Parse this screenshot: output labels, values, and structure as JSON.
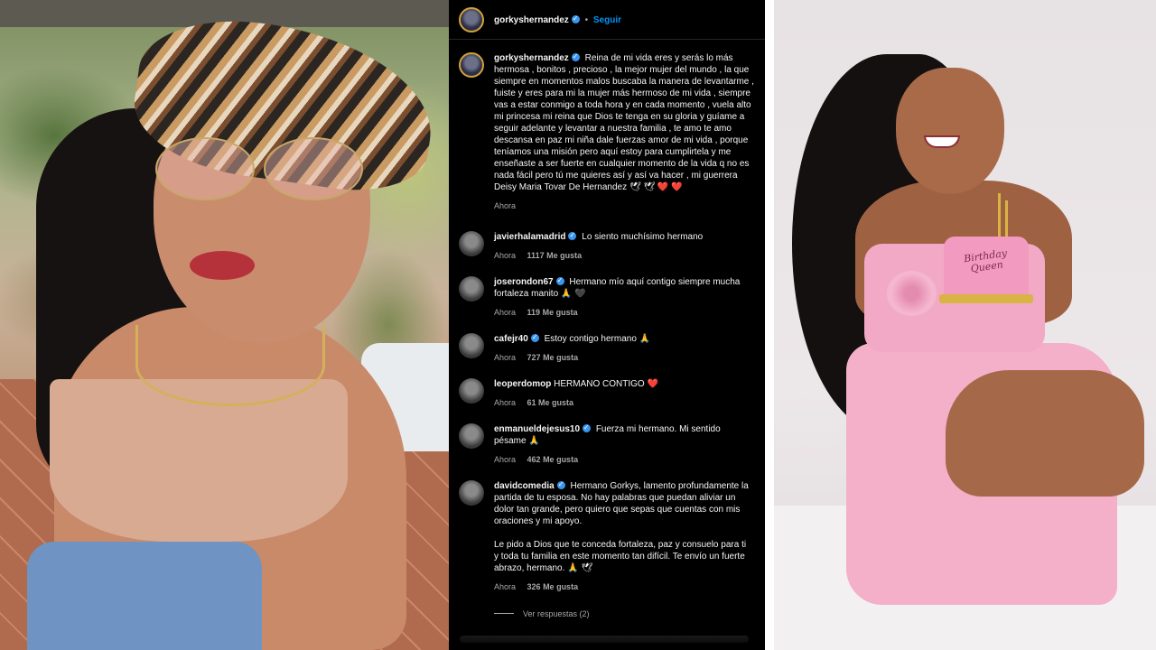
{
  "post": {
    "author": "gorkyshernandez",
    "follow_label": "Seguir",
    "separator": "•",
    "caption": "Reina de mi vida eres y serás lo más hermosa , bonitos , precioso , la mejor mujer del mundo , la que siempre en momentos malos buscaba la manera de levantarme , fuiste y eres para mi la mujer más hermoso de mi vida , siempre vas a estar conmigo a toda hora y en cada momento , vuela alto mi princesa mi reina que Dios te tenga en su gloria y guíame a seguir adelante y levantar a nuestra familia , te amo te amo descansa en paz mi niña dale fuerzas amor de mi vida , porque teníamos una misión pero aquí estoy para cumplirtela y me enseñaste a ser fuerte en cualquier momento de la vida q no es nada fácil pero tú me quieres así y así va hacer , mi guerrera Deisy Maria Tovar De Hernandez 🕊 🕊 ❤️ ❤️",
    "time": "Ahora"
  },
  "comments": [
    {
      "user": "javierhalamadrid",
      "text": "Lo siento muchísimo hermano",
      "time": "Ahora",
      "likes": "1117 Me gusta"
    },
    {
      "user": "joserondon67",
      "text": "Hermano mío aquí contigo siempre mucha fortaleza manito 🙏 🖤",
      "time": "Ahora",
      "likes": "119 Me gusta"
    },
    {
      "user": "cafejr40",
      "text": "Estoy contigo hermano 🙏",
      "time": "Ahora",
      "likes": "727 Me gusta"
    },
    {
      "user": "leoperdomop",
      "text": "HERMANO CONTIGO ❤️",
      "time": "Ahora",
      "likes": "61 Me gusta"
    },
    {
      "user": "enmanueldejesus10",
      "text": "Fuerza mi hermano. Mi sentido pésame 🙏",
      "time": "Ahora",
      "likes": "462 Me gusta"
    },
    {
      "user": "davidcomedia",
      "text": "Hermano Gorkys, lamento profundamente la partida de tu esposa. No hay palabras que puedan aliviar un dolor tan grande, pero quiero que sepas que cuentas con mis oraciones y mi apoyo.",
      "text2": "Le pido a Dios que te conceda fortaleza, paz y consuelo para ti y toda tu familia en este momento tan difícil. Te envío un fuerte abrazo, hermano. 🙏 🕊",
      "time": "Ahora",
      "likes": "326 Me gusta",
      "replies": "Ver respuestas (2)"
    }
  ],
  "right_photo": {
    "cake_text": "Birthday Queen"
  },
  "colors": {
    "ig_background": "#000000",
    "link_blue": "#0095f6",
    "verified_blue": "#3897f0",
    "muted_text": "#a8a8a8"
  },
  "icons": [
    "verified-badge-icon",
    "heart-icon"
  ]
}
